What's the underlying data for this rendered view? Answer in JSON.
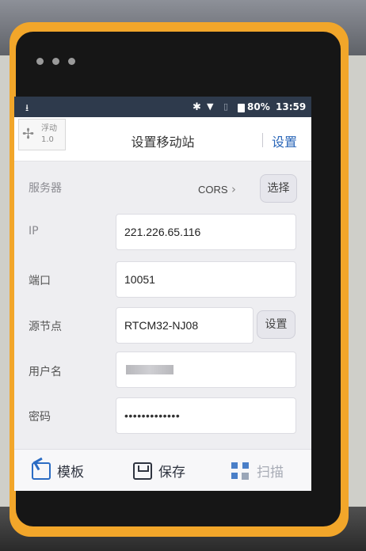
{
  "status_bar": {
    "download_icon": "download-arrow-icon",
    "battery_percent": "80%",
    "time": "13:59"
  },
  "header": {
    "float_label": "浮动",
    "float_version": "1.0",
    "title": "设置移动站",
    "settings_link": "设置"
  },
  "form": {
    "server": {
      "label": "服务器",
      "value": "CORS",
      "choose_button": "选择"
    },
    "ip": {
      "label": "IP",
      "value": "221.226.65.116"
    },
    "port": {
      "label": "端口",
      "value": "10051"
    },
    "mountpoint": {
      "label": "源节点",
      "value": "RTCM32-NJ08",
      "set_button": "设置"
    },
    "username": {
      "label": "用户名",
      "value": ""
    },
    "password": {
      "label": "密码",
      "value": "•••••••••••••"
    }
  },
  "toolbar": {
    "template_label": "模板",
    "save_label": "保存",
    "scan_label": "扫描"
  },
  "colors": {
    "accent": "#2a66b8",
    "status_bar": "#2e3a4c",
    "device_body": "#f2a62a"
  }
}
